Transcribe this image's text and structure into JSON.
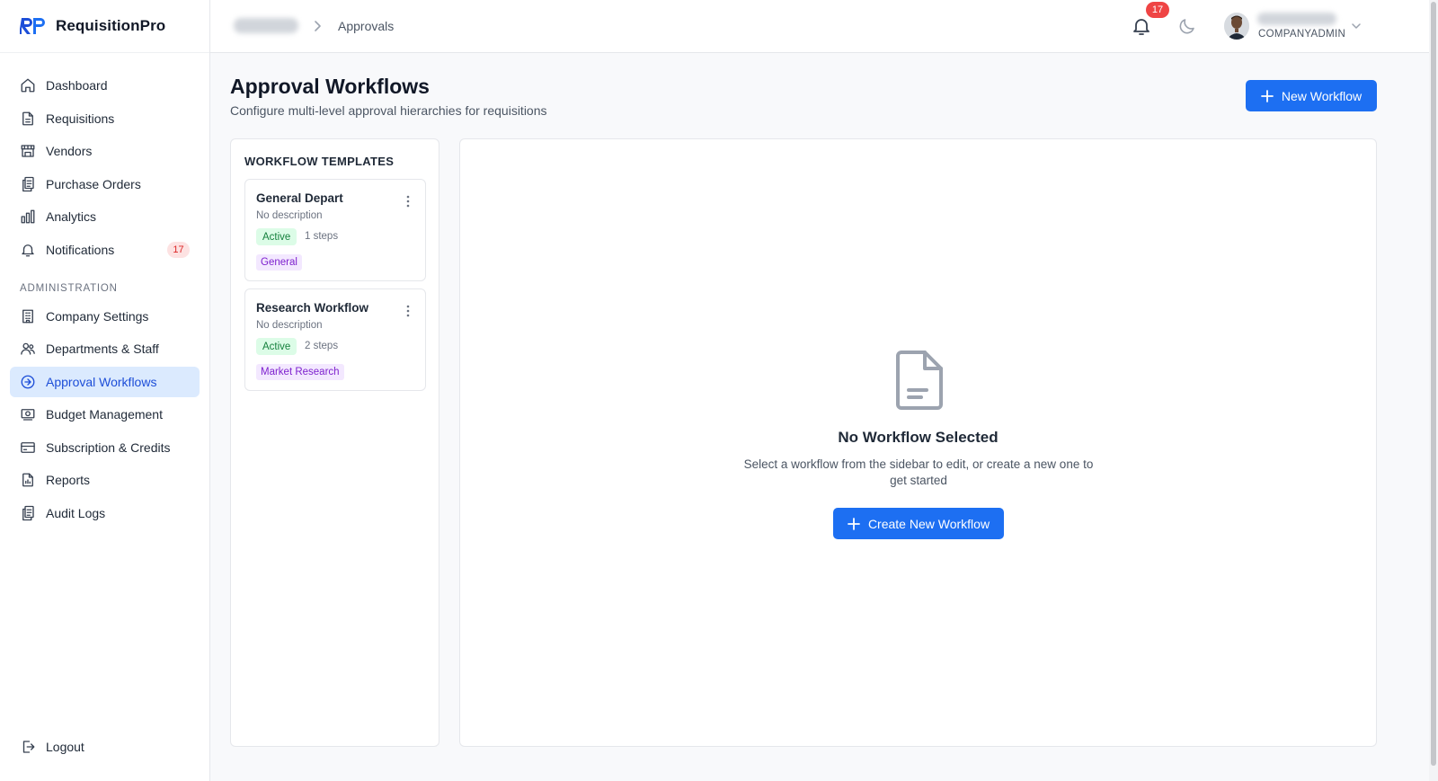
{
  "app": {
    "name": "RequisitionPro",
    "logo_text": "RP",
    "accent_color": "#1d6ff2"
  },
  "sidebar": {
    "items": [
      {
        "label": "Dashboard",
        "icon": "home-icon"
      },
      {
        "label": "Requisitions",
        "icon": "file-icon"
      },
      {
        "label": "Vendors",
        "icon": "store-icon"
      },
      {
        "label": "Purchase Orders",
        "icon": "clipboard-icon"
      },
      {
        "label": "Analytics",
        "icon": "bar-chart-icon"
      },
      {
        "label": "Notifications",
        "icon": "bell-icon",
        "badge": "17"
      }
    ],
    "admin_label": "ADMINISTRATION",
    "admin_items": [
      {
        "label": "Company Settings",
        "icon": "building-icon"
      },
      {
        "label": "Departments & Staff",
        "icon": "users-icon"
      },
      {
        "label": "Approval Workflows",
        "icon": "workflow-icon",
        "active": true
      },
      {
        "label": "Budget Management",
        "icon": "banknote-icon"
      },
      {
        "label": "Subscription & Credits",
        "icon": "credit-card-icon"
      },
      {
        "label": "Reports",
        "icon": "report-icon"
      },
      {
        "label": "Audit Logs",
        "icon": "clipboard-list-icon"
      }
    ],
    "logout_label": "Logout"
  },
  "header": {
    "breadcrumb_current": "Approvals",
    "notification_count": "17",
    "user_role": "COMPANYADMIN"
  },
  "page": {
    "title": "Approval Workflows",
    "subtitle": "Configure multi-level approval hierarchies for requisitions",
    "new_button": "New Workflow"
  },
  "templates": {
    "title": "WORKFLOW TEMPLATES",
    "items": [
      {
        "name": "General Depart",
        "description": "No description",
        "status": "Active",
        "steps": "1 steps",
        "tag": "General"
      },
      {
        "name": "Research Workflow",
        "description": "No description",
        "status": "Active",
        "steps": "2 steps",
        "tag": "Market Research"
      }
    ]
  },
  "empty_state": {
    "title": "No Workflow Selected",
    "description": "Select a workflow from the sidebar to edit, or create a new one to get started",
    "button": "Create New Workflow"
  }
}
